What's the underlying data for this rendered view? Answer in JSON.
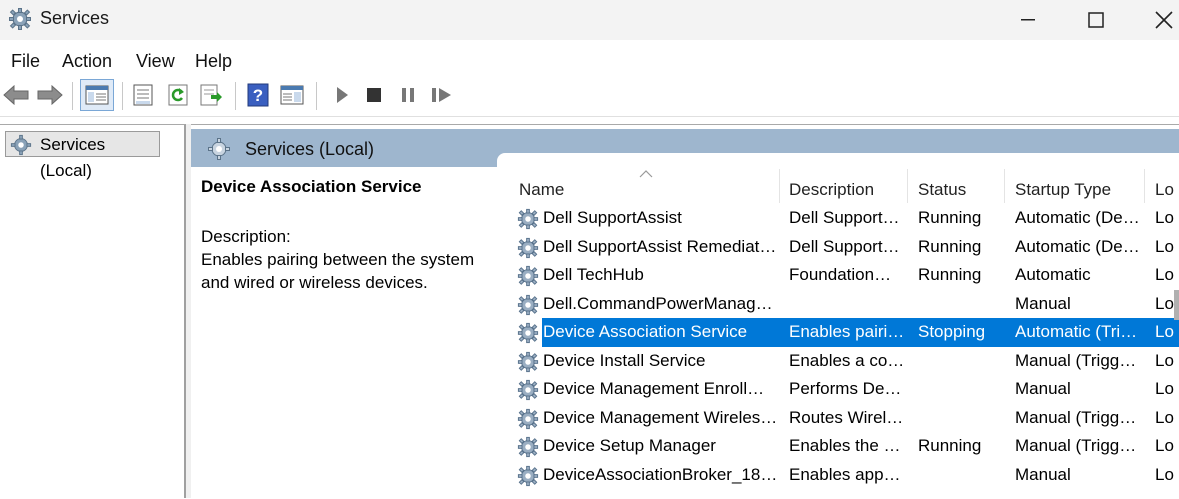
{
  "window": {
    "title": "Services"
  },
  "menu": [
    "File",
    "Action",
    "View",
    "Help"
  ],
  "tree": {
    "item": "Services (Local)"
  },
  "right_header": {
    "label": "Services (Local)"
  },
  "details": {
    "service_name": "Device Association Service",
    "description_label": "Description:",
    "description_text": "Enables pairing between the system and wired or wireless devices."
  },
  "columns": [
    "Name",
    "Description",
    "Status",
    "Startup Type",
    "Lo"
  ],
  "rows": [
    {
      "name": "Dell SupportAssist",
      "description": "Dell Support…",
      "status": "Running",
      "startup": "Automatic (De…",
      "logon": "Lo"
    },
    {
      "name": "Dell SupportAssist Remediat…",
      "description": "Dell Support…",
      "status": "Running",
      "startup": "Automatic (De…",
      "logon": "Lo"
    },
    {
      "name": "Dell TechHub",
      "description": "Foundation…",
      "status": "Running",
      "startup": "Automatic",
      "logon": "Lo"
    },
    {
      "name": "Dell.CommandPowerManag…",
      "description": "",
      "status": "",
      "startup": "Manual",
      "logon": "Lo"
    },
    {
      "name": "Device Association Service",
      "description": "Enables pairi…",
      "status": "Stopping",
      "startup": "Automatic (Tri…",
      "logon": "Lo",
      "selected": true
    },
    {
      "name": "Device Install Service",
      "description": "Enables a co…",
      "status": "",
      "startup": "Manual (Trigg…",
      "logon": "Lo"
    },
    {
      "name": "Device Management Enroll…",
      "description": "Performs De…",
      "status": "",
      "startup": "Manual",
      "logon": "Lo"
    },
    {
      "name": "Device Management Wireles…",
      "description": "Routes Wirel…",
      "status": "",
      "startup": "Manual (Trigg…",
      "logon": "Lo"
    },
    {
      "name": "Device Setup Manager",
      "description": "Enables the …",
      "status": "Running",
      "startup": "Manual (Trigg…",
      "logon": "Lo"
    },
    {
      "name": "DeviceAssociationBroker_18…",
      "description": "Enables app…",
      "status": "",
      "startup": "Manual",
      "logon": "Lo"
    }
  ],
  "colors": {
    "selection": "#0078d7",
    "header_band": "#9eb6ce"
  },
  "icons": [
    "gear-icon",
    "back-arrow-icon",
    "forward-arrow-icon",
    "console-tree-icon",
    "properties-icon",
    "refresh-icon",
    "export-list-icon",
    "help-icon",
    "view-icon",
    "play-icon",
    "stop-icon",
    "pause-icon",
    "restart-icon",
    "minimize-icon",
    "maximize-icon",
    "close-icon"
  ]
}
